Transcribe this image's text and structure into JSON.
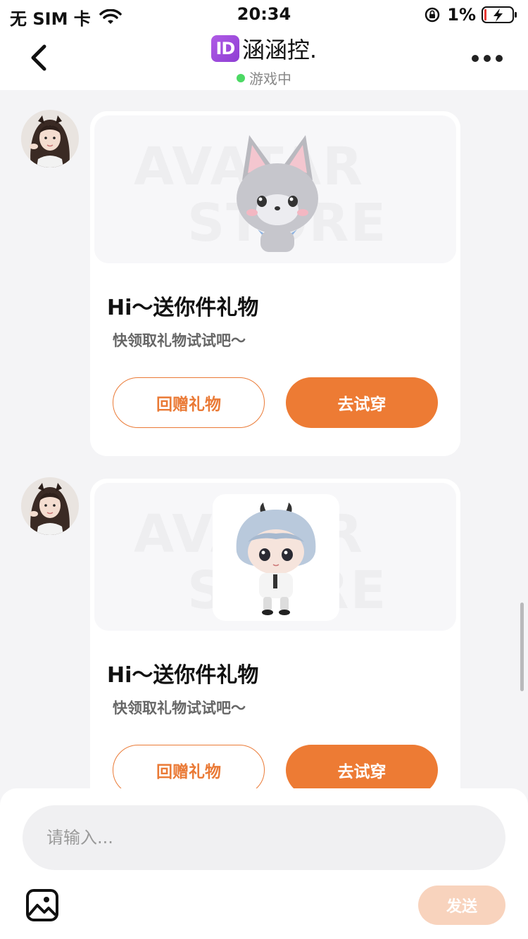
{
  "status_bar": {
    "carrier": "无 SIM 卡",
    "time": "20:34",
    "battery_percent": "1%"
  },
  "nav": {
    "title_badge": "ID",
    "title": "涵涵控.",
    "status": "游戏中",
    "status_color": "#4cd964"
  },
  "messages": [
    {
      "watermark_line1": "AVATAR",
      "watermark_line2": "STORE",
      "title": "Hi～送你件礼物",
      "subtitle": "快领取礼物试试吧～",
      "return_gift_label": "回赠礼物",
      "try_on_label": "去试穿",
      "gift_icon": "gray-fox-plush-icon"
    },
    {
      "watermark_line1": "AVATAR",
      "watermark_line2": "STORE",
      "title": "Hi～送你件礼物",
      "subtitle": "快领取礼物试试吧～",
      "return_gift_label": "回赠礼物",
      "try_on_label": "去试穿",
      "gift_icon": "chibi-demon-boy-icon"
    }
  ],
  "composer": {
    "placeholder": "请输入...",
    "send_label": "发送"
  },
  "colors": {
    "accent": "#ed7b34",
    "send_disabled": "#f8d3bd"
  }
}
